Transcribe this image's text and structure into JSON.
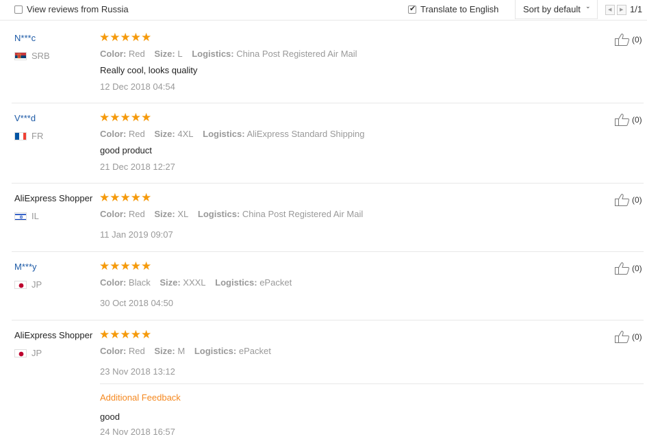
{
  "toolbar": {
    "view_reviews_label": "View reviews from Russia",
    "view_reviews_checked": false,
    "translate_label": "Translate to English",
    "translate_checked": true,
    "sort_label": "Sort by default",
    "page_indicator": "1/1"
  },
  "reviews": [
    {
      "user": "N***c",
      "country": "SRB",
      "stars": "★★★★★",
      "color_label": "Color:",
      "color": "Red",
      "size_label": "Size:",
      "size": "L",
      "logistics_label": "Logistics:",
      "logistics": "China Post Registered Air Mail",
      "feedback": "Really cool, looks quality",
      "date": "12 Dec 2018 04:54",
      "likes": "(0)"
    },
    {
      "user": "V***d",
      "country": "FR",
      "stars": "★★★★★",
      "color_label": "Color:",
      "color": "Red",
      "size_label": "Size:",
      "size": "4XL",
      "logistics_label": "Logistics:",
      "logistics": "AliExpress Standard Shipping",
      "feedback": "good product",
      "date": "21 Dec 2018 12:27",
      "likes": "(0)"
    },
    {
      "user": "AliExpress Shopper",
      "country": "IL",
      "stars": "★★★★★",
      "color_label": "Color:",
      "color": "Red",
      "size_label": "Size:",
      "size": "XL",
      "logistics_label": "Logistics:",
      "logistics": "China Post Registered Air Mail",
      "date": "11 Jan 2019 09:07",
      "likes": "(0)"
    },
    {
      "user": "M***y",
      "country": "JP",
      "stars": "★★★★★",
      "color_label": "Color:",
      "color": "Black",
      "size_label": "Size:",
      "size": "XXXL",
      "logistics_label": "Logistics:",
      "logistics": "ePacket",
      "date": "30 Oct 2018 04:50",
      "likes": "(0)"
    },
    {
      "user": "AliExpress Shopper",
      "country": "JP",
      "stars": "★★★★★",
      "color_label": "Color:",
      "color": "Red",
      "size_label": "Size:",
      "size": "M",
      "logistics_label": "Logistics:",
      "logistics": "ePacket",
      "date": "23 Nov 2018 13:12",
      "likes": "(0)",
      "additional_title": "Additional Feedback",
      "additional_text": "good",
      "additional_date": "24 Nov 2018 16:57"
    }
  ],
  "icons": {
    "like": "thumbs-up-icon",
    "flag_SRB": "serbia-flag-icon",
    "flag_FR": "france-flag-icon",
    "flag_IL": "israel-flag-icon",
    "flag_JP": "japan-flag-icon"
  },
  "colors": {
    "link_blue": "#1d5aa6",
    "star_orange": "#f59a0c",
    "additional_orange": "#f5881f",
    "muted_gray": "#999999"
  }
}
